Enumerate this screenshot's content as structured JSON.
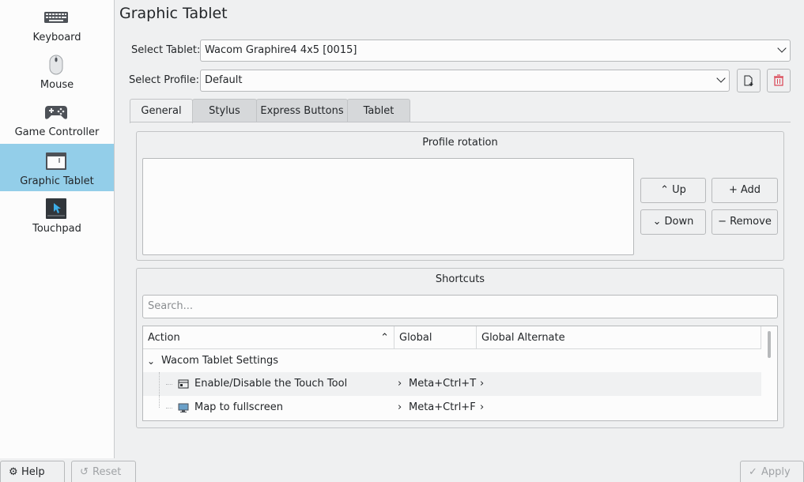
{
  "sidebar": {
    "items": [
      {
        "label": "Keyboard",
        "icon": "keyboard-icon"
      },
      {
        "label": "Mouse",
        "icon": "mouse-icon"
      },
      {
        "label": "Game Controller",
        "icon": "gamepad-icon"
      },
      {
        "label": "Graphic Tablet",
        "icon": "tablet-icon",
        "active": true
      },
      {
        "label": "Touchpad",
        "icon": "touchpad-icon"
      }
    ]
  },
  "page": {
    "title": "Graphic Tablet"
  },
  "select_tablet": {
    "label": "Select Tablet:",
    "value": "Wacom Graphire4 4x5 [0015]"
  },
  "select_profile": {
    "label": "Select Profile:",
    "value": "Default"
  },
  "tabs": [
    {
      "label": "General",
      "active": true
    },
    {
      "label": "Stylus"
    },
    {
      "label": "Express Buttons"
    },
    {
      "label": "Tablet"
    }
  ],
  "profile_rotation": {
    "title": "Profile rotation",
    "buttons": {
      "up": "Up",
      "add": "Add",
      "down": "Down",
      "remove": "Remove"
    }
  },
  "shortcuts": {
    "title": "Shortcuts",
    "search_placeholder": "Search...",
    "columns": [
      "Action",
      "Global",
      "Global Alternate"
    ],
    "group": "Wacom Tablet Settings",
    "rows": [
      {
        "action": "Enable/Disable the Touch Tool",
        "global": "Meta+Ctrl+T",
        "alternate": ""
      },
      {
        "action": "Map to fullscreen",
        "global": "Meta+Ctrl+F",
        "alternate": ""
      }
    ]
  },
  "footer": {
    "help": "Help",
    "reset": "Reset",
    "apply": "Apply"
  },
  "colors": {
    "accent": "#93cee9",
    "background": "#eff0f1",
    "field": "#fcfcfc",
    "delete_red": "#da4453"
  }
}
